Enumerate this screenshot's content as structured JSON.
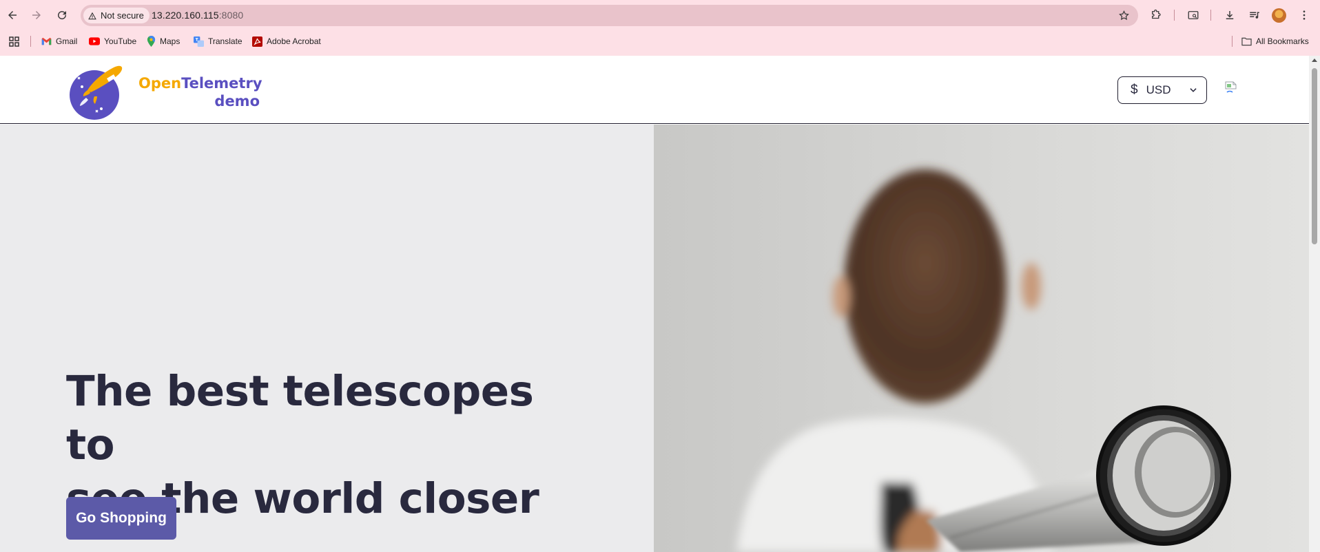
{
  "browser": {
    "security_label": "Not secure",
    "url_host": "13.220.160.115",
    "url_port": ":8080",
    "bookmarks": [
      {
        "label": "Gmail",
        "icon": "gmail-icon"
      },
      {
        "label": "YouTube",
        "icon": "youtube-icon"
      },
      {
        "label": "Maps",
        "icon": "maps-icon"
      },
      {
        "label": "Translate",
        "icon": "translate-icon"
      },
      {
        "label": "Adobe Acrobat",
        "icon": "acrobat-icon"
      }
    ],
    "all_bookmarks_label": "All Bookmarks"
  },
  "site": {
    "logo": {
      "open": "Open",
      "telemetry": "Telemetry",
      "demo": "demo"
    },
    "currency": {
      "symbol": "$",
      "code": "USD"
    },
    "hero": {
      "title_line1": "The best telescopes to",
      "title_line2": "see the world closer",
      "cta_label": "Go Shopping"
    }
  },
  "colors": {
    "accent": "#5c5aa8",
    "title": "#29293e",
    "logo_yellow": "#f5a800",
    "logo_purple": "#5a4fc0",
    "chrome_bg": "#fde0e6"
  }
}
